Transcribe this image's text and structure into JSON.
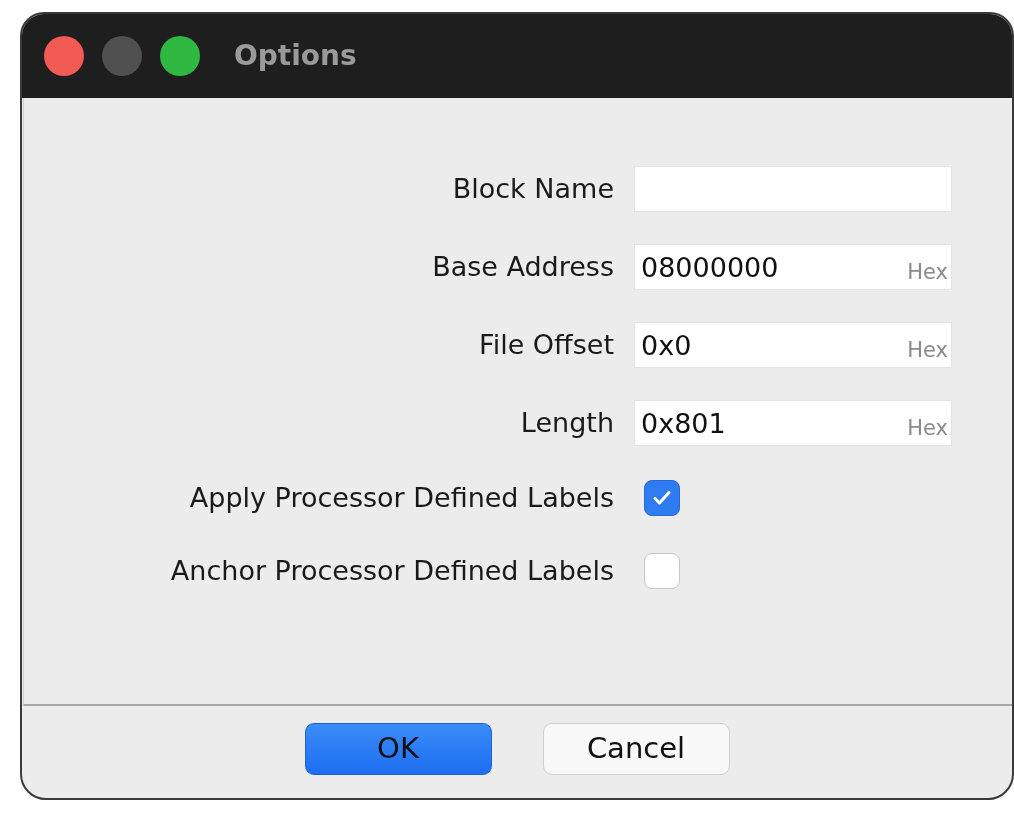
{
  "window": {
    "title": "Options"
  },
  "fields": [
    {
      "label": "Block Name"
    },
    {
      "label": "Base Address",
      "value": "08000000",
      "unit": "Hex"
    },
    {
      "label": "File Offset",
      "value": "0x0",
      "unit": "Hex"
    },
    {
      "label": "Length",
      "value": "0x801",
      "unit": "Hex"
    }
  ],
  "checkboxes": [
    {
      "label": "Apply Processor Defined Labels",
      "checked": true
    },
    {
      "label": "Anchor Processor Defined Labels",
      "checked": false
    }
  ],
  "buttons": [
    {
      "label": "OK",
      "kind": "primary"
    },
    {
      "label": "Cancel",
      "kind": "secondary"
    }
  ]
}
